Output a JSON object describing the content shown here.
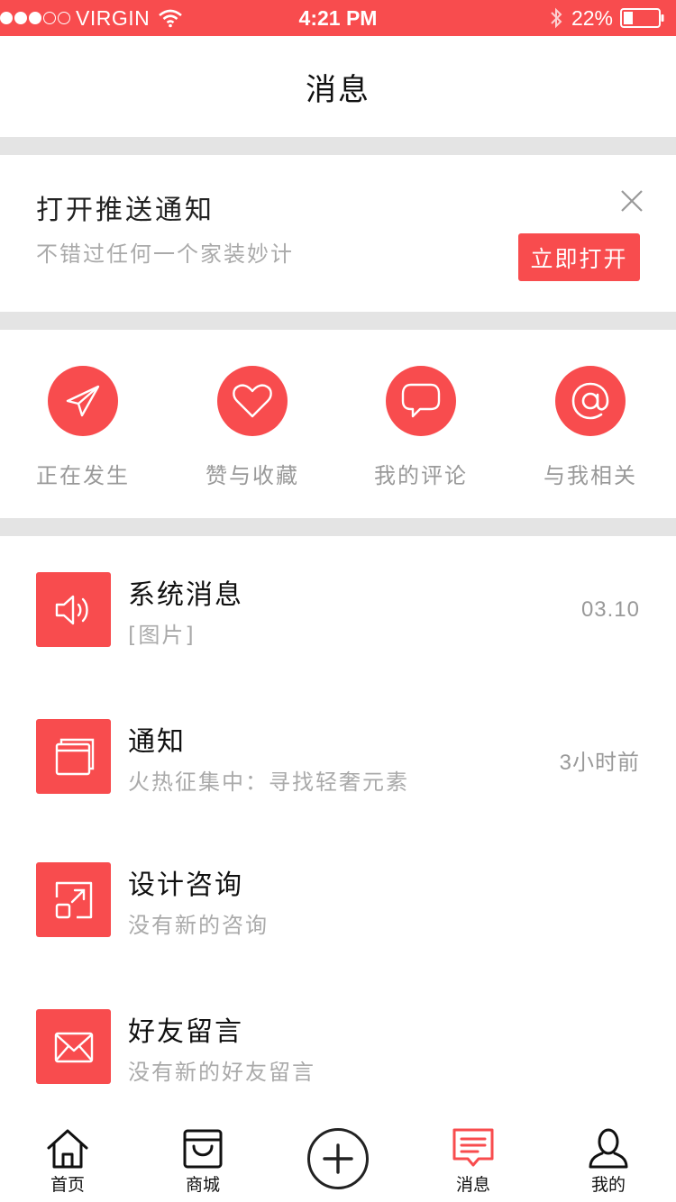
{
  "status_bar": {
    "carrier": "VIRGIN",
    "time": "4:21 PM",
    "battery": "22%"
  },
  "header": {
    "title": "消息"
  },
  "push_banner": {
    "title": "打开推送通知",
    "subtitle": "不错过任何一个家装妙计",
    "button_label": "立即打开"
  },
  "quick_actions": [
    {
      "label": "正在发生",
      "icon": "paper-plane-icon"
    },
    {
      "label": "赞与收藏",
      "icon": "heart-icon"
    },
    {
      "label": "我的评论",
      "icon": "comment-bubble-icon"
    },
    {
      "label": "与我相关",
      "icon": "at-sign-icon"
    }
  ],
  "messages": [
    {
      "title": "系统消息",
      "subtitle": "[图片]",
      "time": "03.10",
      "icon": "speaker-icon"
    },
    {
      "title": "通知",
      "subtitle": "火热征集中：寻找轻奢元素",
      "time": "3小时前",
      "icon": "window-stack-icon"
    },
    {
      "title": "设计咨询",
      "subtitle": "没有新的咨询",
      "time": "",
      "icon": "resize-arrow-icon"
    },
    {
      "title": "好友留言",
      "subtitle": "没有新的好友留言",
      "time": "",
      "icon": "envelope-icon"
    }
  ],
  "tab_bar": {
    "items": [
      {
        "label": "首页",
        "icon": "home-icon"
      },
      {
        "label": "商城",
        "icon": "shop-bag-icon"
      },
      {
        "label": "",
        "icon": "plus-circle-icon"
      },
      {
        "label": "消息",
        "icon": "message-icon",
        "active": true
      },
      {
        "label": "我的",
        "icon": "user-icon"
      }
    ]
  },
  "colors": {
    "accent": "#f84c4e",
    "divider": "#e4e4e4",
    "muted_text": "#aaaaaa"
  }
}
